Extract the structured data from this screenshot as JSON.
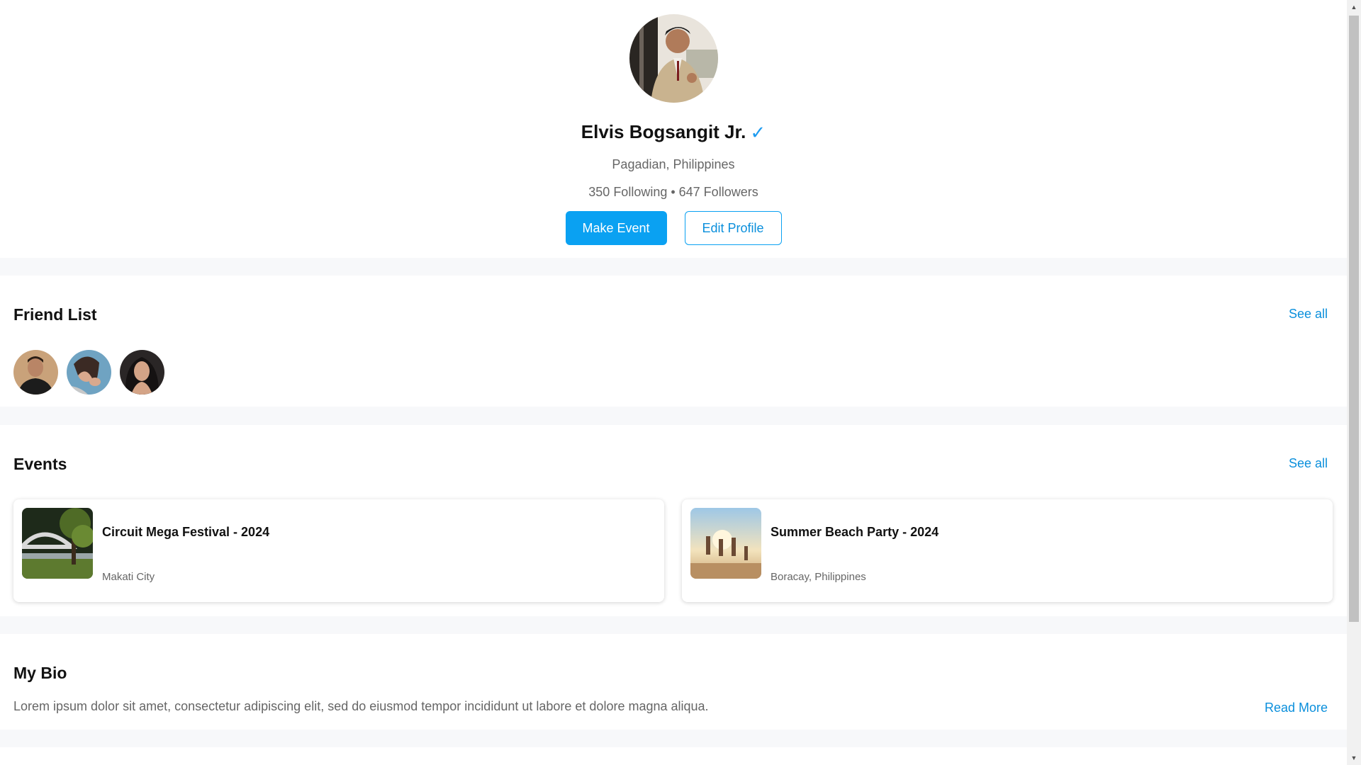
{
  "profile": {
    "name": "Elvis Bogsangit Jr.",
    "verified_icon": "✓",
    "location": "Pagadian, Philippines",
    "stats": "350 Following • 647 Followers",
    "make_event_label": "Make Event",
    "edit_profile_label": "Edit Profile"
  },
  "friends": {
    "title": "Friend List",
    "see_all": "See all"
  },
  "events": {
    "title": "Events",
    "see_all": "See all",
    "items": [
      {
        "title": "Circuit Mega Festival - 2024",
        "location": "Makati City"
      },
      {
        "title": "Summer Beach Party - 2024",
        "location": "Boracay, Philippines"
      }
    ]
  },
  "bio": {
    "title": "My Bio",
    "text": "Lorem ipsum dolor sit amet, consectetur adipiscing elit, sed do eiusmod tempor incididunt ut labore et dolore magna aliqua.",
    "read_more": "Read More"
  },
  "colors": {
    "accent": "#0aa1f2",
    "link": "#0a8fdc",
    "verified": "#1d9bf0",
    "muted_text": "#666666",
    "page_bg": "#f7f8fa"
  }
}
